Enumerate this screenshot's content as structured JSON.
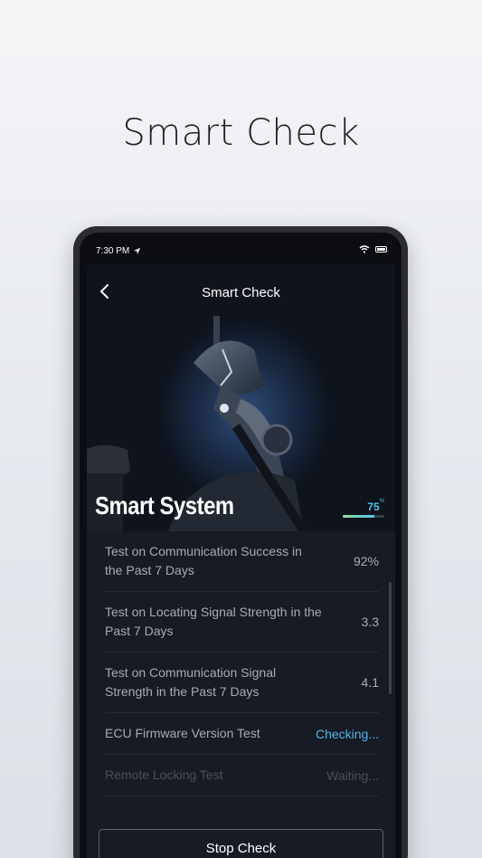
{
  "page": {
    "headline": "Smart Check"
  },
  "status_bar": {
    "time": "7:30 PM"
  },
  "nav": {
    "title": "Smart Check"
  },
  "hero": {
    "system_label": "Smart System",
    "score": "75",
    "score_unit": "%",
    "score_fraction": 0.75
  },
  "checks": [
    {
      "label": "Test on Communication Success in the Past 7 Days",
      "value": "92%",
      "state": "done"
    },
    {
      "label": "Test on Locating Signal Strength in the Past 7 Days",
      "value": "3.3",
      "state": "done"
    },
    {
      "label": "Test on Communication Signal Strength in the Past 7 Days",
      "value": "4.1",
      "state": "done"
    },
    {
      "label": "ECU Firmware Version Test",
      "value": "Checking...",
      "state": "checking"
    },
    {
      "label": "Remote Locking Test",
      "value": "Waiting...",
      "state": "waiting"
    }
  ],
  "actions": {
    "stop_label": "Stop Check"
  },
  "colors": {
    "accent": "#4fb7e6",
    "background": "#13161c"
  }
}
